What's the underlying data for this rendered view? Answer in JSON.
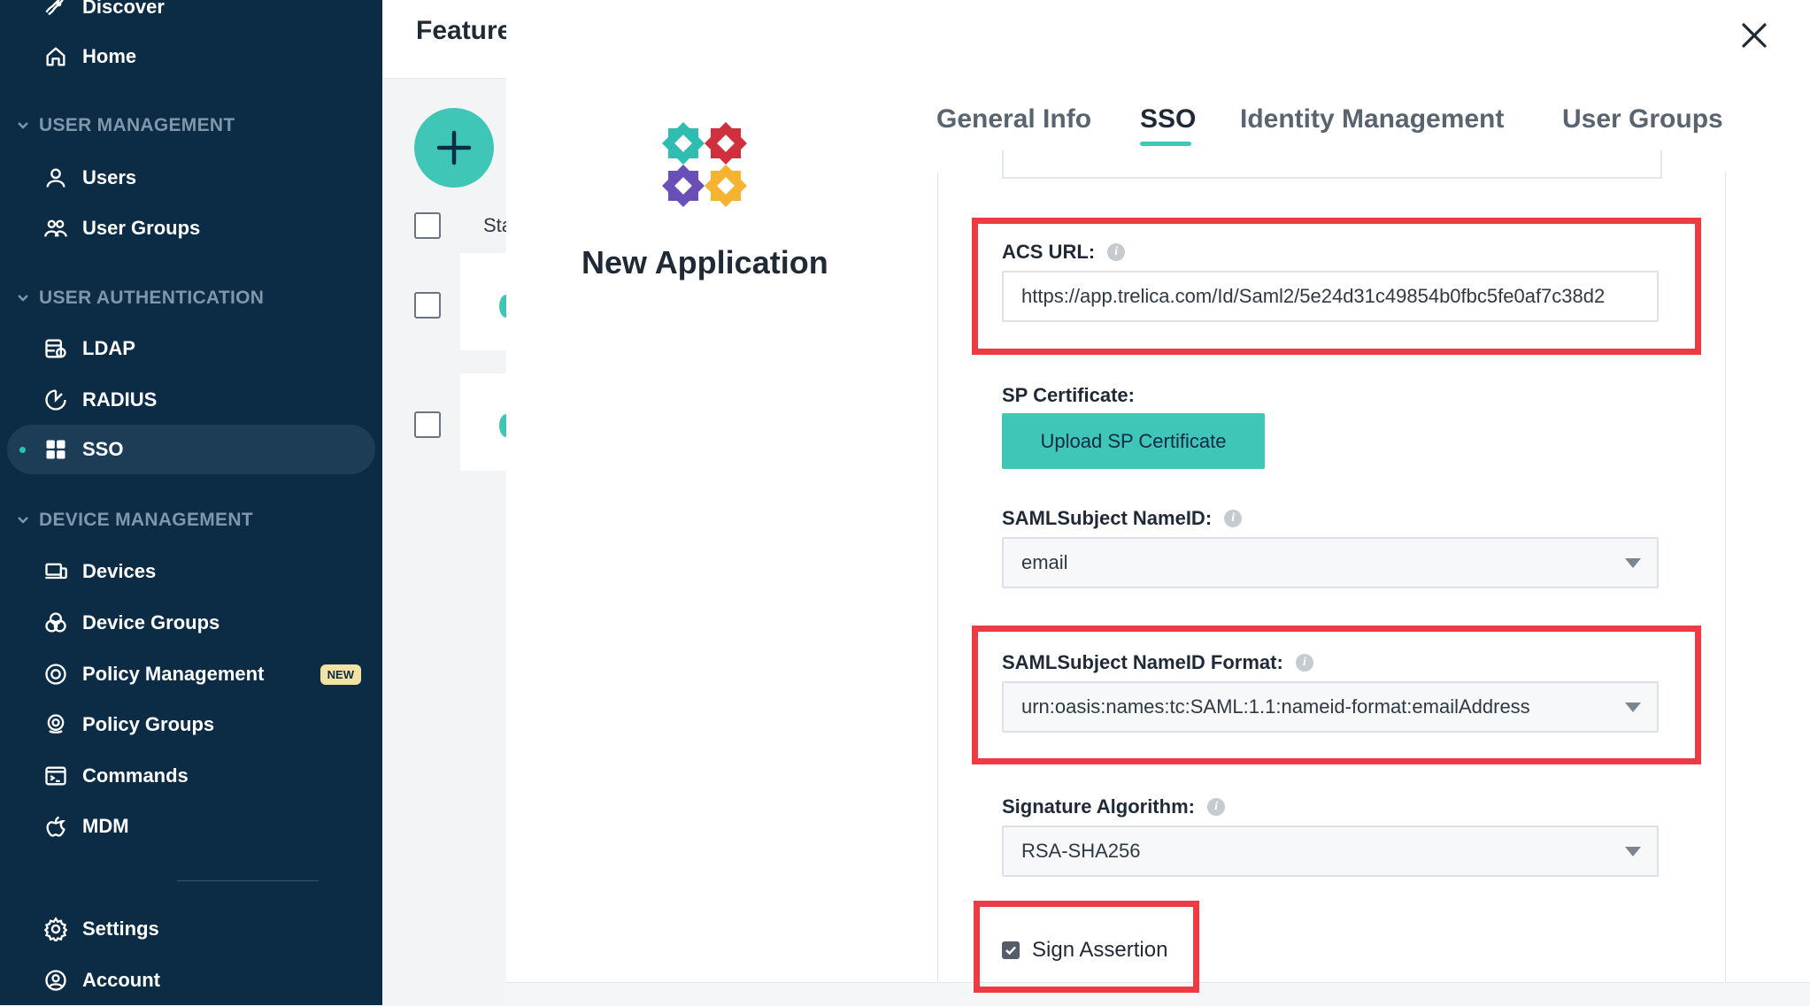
{
  "sidebar": {
    "items": [
      {
        "label": "Discover",
        "icon": "rocket-icon"
      },
      {
        "label": "Home",
        "icon": "home-icon"
      },
      {
        "label": "Users",
        "icon": "user-icon"
      },
      {
        "label": "User Groups",
        "icon": "user-groups-icon"
      },
      {
        "label": "LDAP",
        "icon": "ldap-icon"
      },
      {
        "label": "RADIUS",
        "icon": "radius-icon"
      },
      {
        "label": "SSO",
        "icon": "sso-grid-icon"
      },
      {
        "label": "Devices",
        "icon": "devices-icon"
      },
      {
        "label": "Device Groups",
        "icon": "device-groups-icon"
      },
      {
        "label": "Policy Management",
        "icon": "policy-icon",
        "badge": "NEW"
      },
      {
        "label": "Policy Groups",
        "icon": "policy-groups-icon"
      },
      {
        "label": "Commands",
        "icon": "terminal-icon"
      },
      {
        "label": "MDM",
        "icon": "apple-icon"
      },
      {
        "label": "Settings",
        "icon": "gear-icon"
      },
      {
        "label": "Account",
        "icon": "account-icon"
      }
    ],
    "sections": [
      "USER MANAGEMENT",
      "USER AUTHENTICATION",
      "DEVICE MANAGEMENT"
    ],
    "active_item": "SSO"
  },
  "background": {
    "title": "Feature",
    "column_header": "Sta"
  },
  "modal": {
    "app_title": "New Application",
    "tabs": [
      {
        "label": "General Info"
      },
      {
        "label": "SSO",
        "active": true
      },
      {
        "label": "Identity Management"
      },
      {
        "label": "User Groups"
      }
    ],
    "form": {
      "acs_url": {
        "label": "ACS URL:",
        "value": "https://app.trelica.com/Id/Saml2/5e24d31c49854b0fbc5fe0af7c38d2"
      },
      "sp_certificate": {
        "label": "SP Certificate:",
        "button": "Upload SP Certificate"
      },
      "subject_nameid": {
        "label": "SAMLSubject NameID:",
        "value": "email"
      },
      "subject_nameid_format": {
        "label": "SAMLSubject NameID Format:",
        "value": "urn:oasis:names:tc:SAML:1.1:nameid-format:emailAddress"
      },
      "signature_algorithm": {
        "label": "Signature Algorithm:",
        "value": "RSA-SHA256"
      },
      "sign_assertion": {
        "label": "Sign Assertion",
        "checked": true
      }
    }
  },
  "colors": {
    "sidebar_bg": "#0c2b45",
    "accent": "#3fc6b7",
    "highlight": "#ee3a43"
  }
}
